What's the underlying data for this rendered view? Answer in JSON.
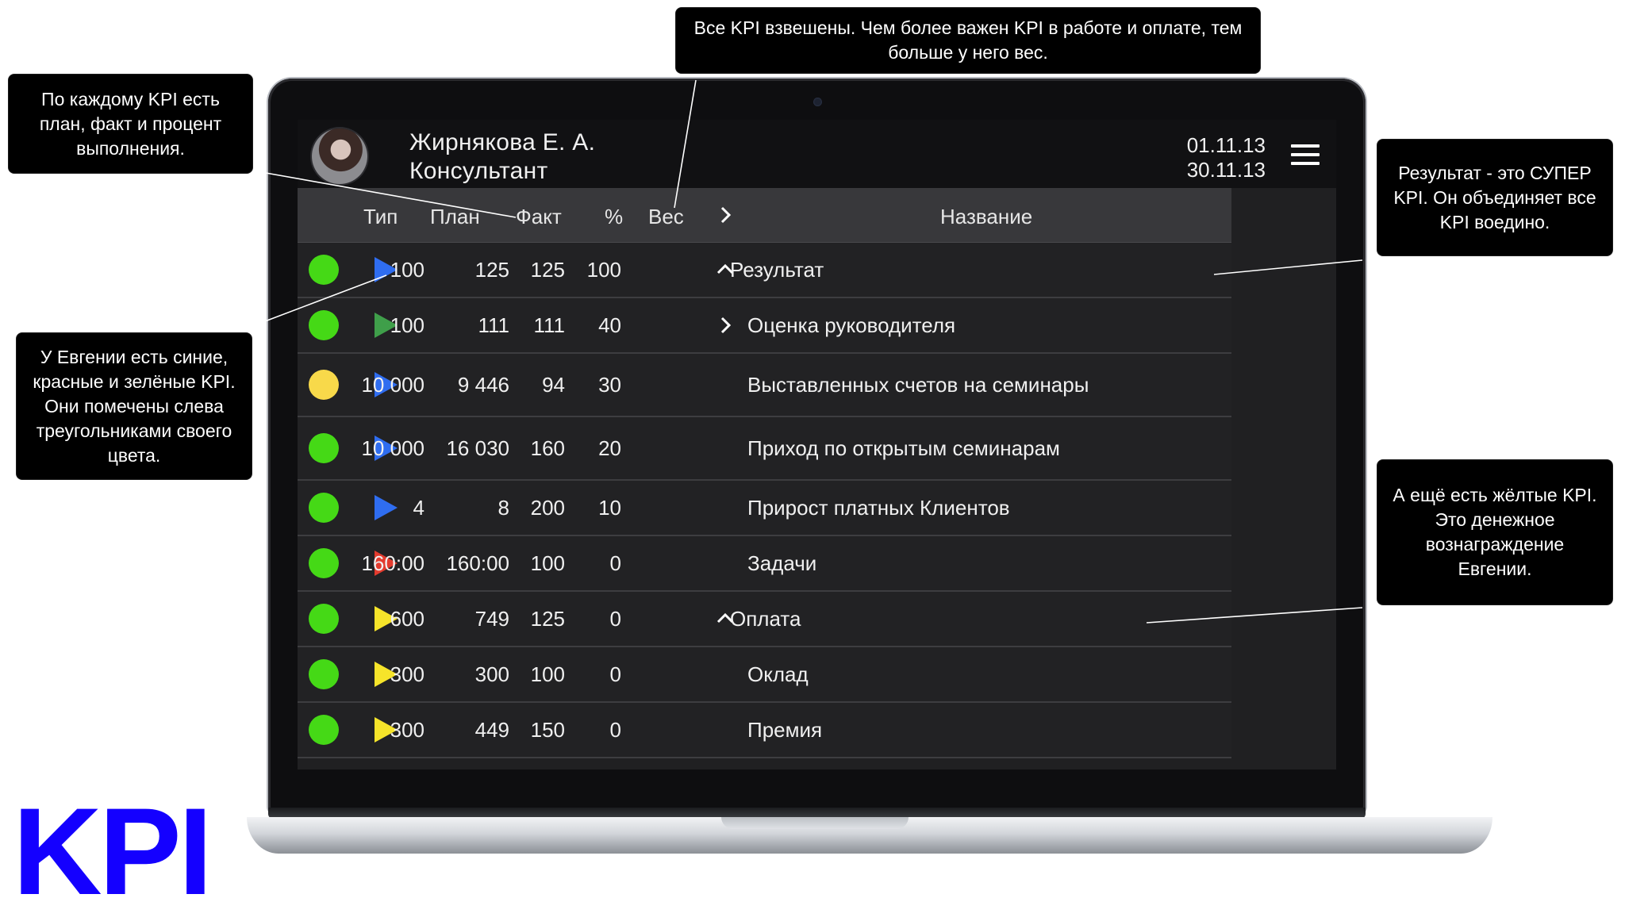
{
  "header": {
    "user_name": "Жирнякова Е. А.",
    "user_role": "Консультант",
    "date_from": "01.11.13",
    "date_to": "30.11.13",
    "avatar_icon": "user-photo",
    "menu_icon": "hamburger-menu-icon"
  },
  "columns": {
    "type": "Тип",
    "plan": "План",
    "fact": "Факт",
    "percent": "%",
    "weight": "Вес",
    "name": "Название"
  },
  "colors": {
    "green": "#45d916",
    "yellow": "#f8d94a",
    "blue": "#2f6df0",
    "dark_green": "#3f9f4a",
    "red": "#e33b2e",
    "kpi_yellow": "#f6e42a",
    "logo_blue": "#1400ff"
  },
  "rows": [
    {
      "status": "green",
      "type": "blue",
      "plan": "100",
      "fact": "125",
      "percent": "125",
      "weight": "100",
      "chevron": "up",
      "name": "Результат",
      "indent": 0
    },
    {
      "status": "green",
      "type": "dark_green",
      "plan": "100",
      "fact": "111",
      "percent": "111",
      "weight": "40",
      "chevron": "right",
      "name": "Оценка руководителя",
      "indent": 1
    },
    {
      "status": "yellow",
      "type": "blue",
      "plan": "10 000",
      "fact": "9 446",
      "percent": "94",
      "weight": "30",
      "chevron": "",
      "name": "Выставленных счетов на семинары",
      "indent": 1
    },
    {
      "status": "green",
      "type": "blue",
      "plan": "10 000",
      "fact": "16 030",
      "percent": "160",
      "weight": "20",
      "chevron": "",
      "name": "Приход по открытым семинарам",
      "indent": 1
    },
    {
      "status": "green",
      "type": "blue",
      "plan": "4",
      "fact": "8",
      "percent": "200",
      "weight": "10",
      "chevron": "",
      "name": "Прирост платных Клиентов",
      "indent": 1
    },
    {
      "status": "green",
      "type": "red",
      "plan": "160:00",
      "fact": "160:00",
      "percent": "100",
      "weight": "0",
      "chevron": "",
      "name": "Задачи",
      "indent": 1
    },
    {
      "status": "green",
      "type": "kpi_yellow",
      "plan": "600",
      "fact": "749",
      "percent": "125",
      "weight": "0",
      "chevron": "up",
      "name": "Оплата",
      "indent": 0
    },
    {
      "status": "green",
      "type": "kpi_yellow",
      "plan": "300",
      "fact": "300",
      "percent": "100",
      "weight": "0",
      "chevron": "",
      "name": "Оклад",
      "indent": 1
    },
    {
      "status": "green",
      "type": "kpi_yellow",
      "plan": "300",
      "fact": "449",
      "percent": "150",
      "weight": "0",
      "chevron": "",
      "name": "Премия",
      "indent": 1
    }
  ],
  "callouts": {
    "weights": "Все KPI взвешены. Чем более важен KPI в работе и оплате, тем больше у него вес.",
    "plan_fact": "По каждому KPI есть план, факт и процент выполнения.",
    "colors": "У Евгении есть синие, красные и зелёные KPI. Они помечены слева треугольниками своего цвета.",
    "result": "Результат - это СУПЕР KPI. Он объединяет все KPI воедино.",
    "yellow": "А ещё есть жёлтые KPI. Это денежное вознаграждение Евгении."
  },
  "logo": "KPI"
}
